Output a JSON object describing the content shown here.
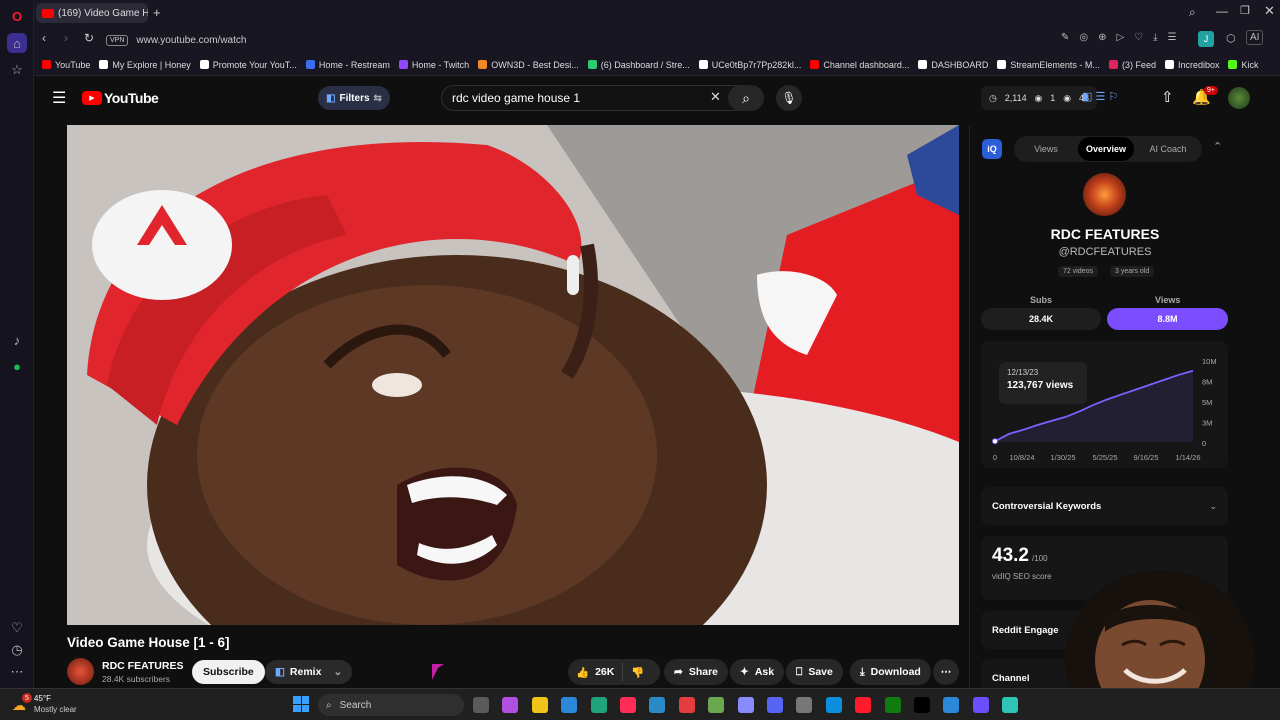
{
  "browser": {
    "tab_title": "(169) Video Game Ho...",
    "vpn_label": "VPN",
    "url": "www.youtube.com/watch",
    "ai_label": "AI",
    "profile_initial": "J",
    "bookmarks": [
      {
        "label": "YouTube",
        "color": "#ff0000"
      },
      {
        "label": "My Explore | Honey",
        "color": "#ffffff"
      },
      {
        "label": "Promote Your YouT...",
        "color": "#ffffff"
      },
      {
        "label": "Home - Restream",
        "color": "#3a6cf4"
      },
      {
        "label": "Home - Twitch",
        "color": "#9146ff"
      },
      {
        "label": "OWN3D - Best Desi...",
        "color": "#f08a24"
      },
      {
        "label": "(6) Dashboard / Stre...",
        "color": "#2ecc71"
      },
      {
        "label": "UCe0tBp7r7Pp282kl...",
        "color": "#ffffff"
      },
      {
        "label": "Channel dashboard...",
        "color": "#ff0000"
      },
      {
        "label": "DASHBOARD",
        "color": "#ffffff"
      },
      {
        "label": "StreamElements - M...",
        "color": "#ffffff"
      },
      {
        "label": "(3) Feed",
        "color": "#e0245e"
      },
      {
        "label": "Incredibox",
        "color": "#ffffff"
      },
      {
        "label": "Kick",
        "color": "#53fc18"
      }
    ]
  },
  "youtube": {
    "logo_text": "YouTube",
    "filters_label": "Filters",
    "search_value": "rdc video game house 1",
    "stats": {
      "a": "2,114",
      "b": "1",
      "c": "48"
    },
    "notification_badge": "9+",
    "video_title": "Video Game House [1 - 6]",
    "channel_name": "RDC FEATURES",
    "subscribers": "28.4K subscribers",
    "subscribe_label": "Subscribe",
    "remix_label": "Remix",
    "likes": "26K",
    "share_label": "Share",
    "ask_label": "Ask",
    "save_label": "Save",
    "download_label": "Download"
  },
  "vidiq": {
    "tabs": [
      "Views",
      "Overview",
      "AI Coach"
    ],
    "channel_title": "RDC FEATURES",
    "channel_handle": "@RDCFEATURES",
    "videos_chip": "72 videos",
    "age_chip": "3 years old",
    "subs_label": "Subs",
    "views_label": "Views",
    "subs_value": "28.4K",
    "views_value": "8.8M",
    "tooltip_date": "12/13/23",
    "tooltip_views": "123,767 views",
    "section_keywords": "Controversial Keywords",
    "seo_score": "43.2",
    "seo_max": "/100",
    "seo_label": "vidIQ SEO score",
    "section_reddit": "Reddit Engage",
    "section_channel": "Channel"
  },
  "chart_data": {
    "type": "line",
    "x_ticks": [
      "0",
      "10/8/24",
      "1/30/25",
      "5/25/25",
      "9/16/25",
      "1/14/26"
    ],
    "y_ticks": [
      "10M",
      "8M",
      "5M",
      "3M",
      "0"
    ],
    "ylim": [
      0,
      10
    ],
    "series": [
      {
        "values": [
          0.1,
          1.0,
          1.5,
          2.1,
          2.6,
          3.1,
          3.8,
          4.6,
          5.3,
          5.9,
          6.5,
          7.1,
          7.7,
          8.3,
          8.8
        ]
      }
    ],
    "color": "#7b61ff"
  },
  "taskbar": {
    "weather_temp": "45°F",
    "weather_desc": "Mostly clear",
    "weather_badge": "5",
    "search_placeholder": "Search"
  }
}
